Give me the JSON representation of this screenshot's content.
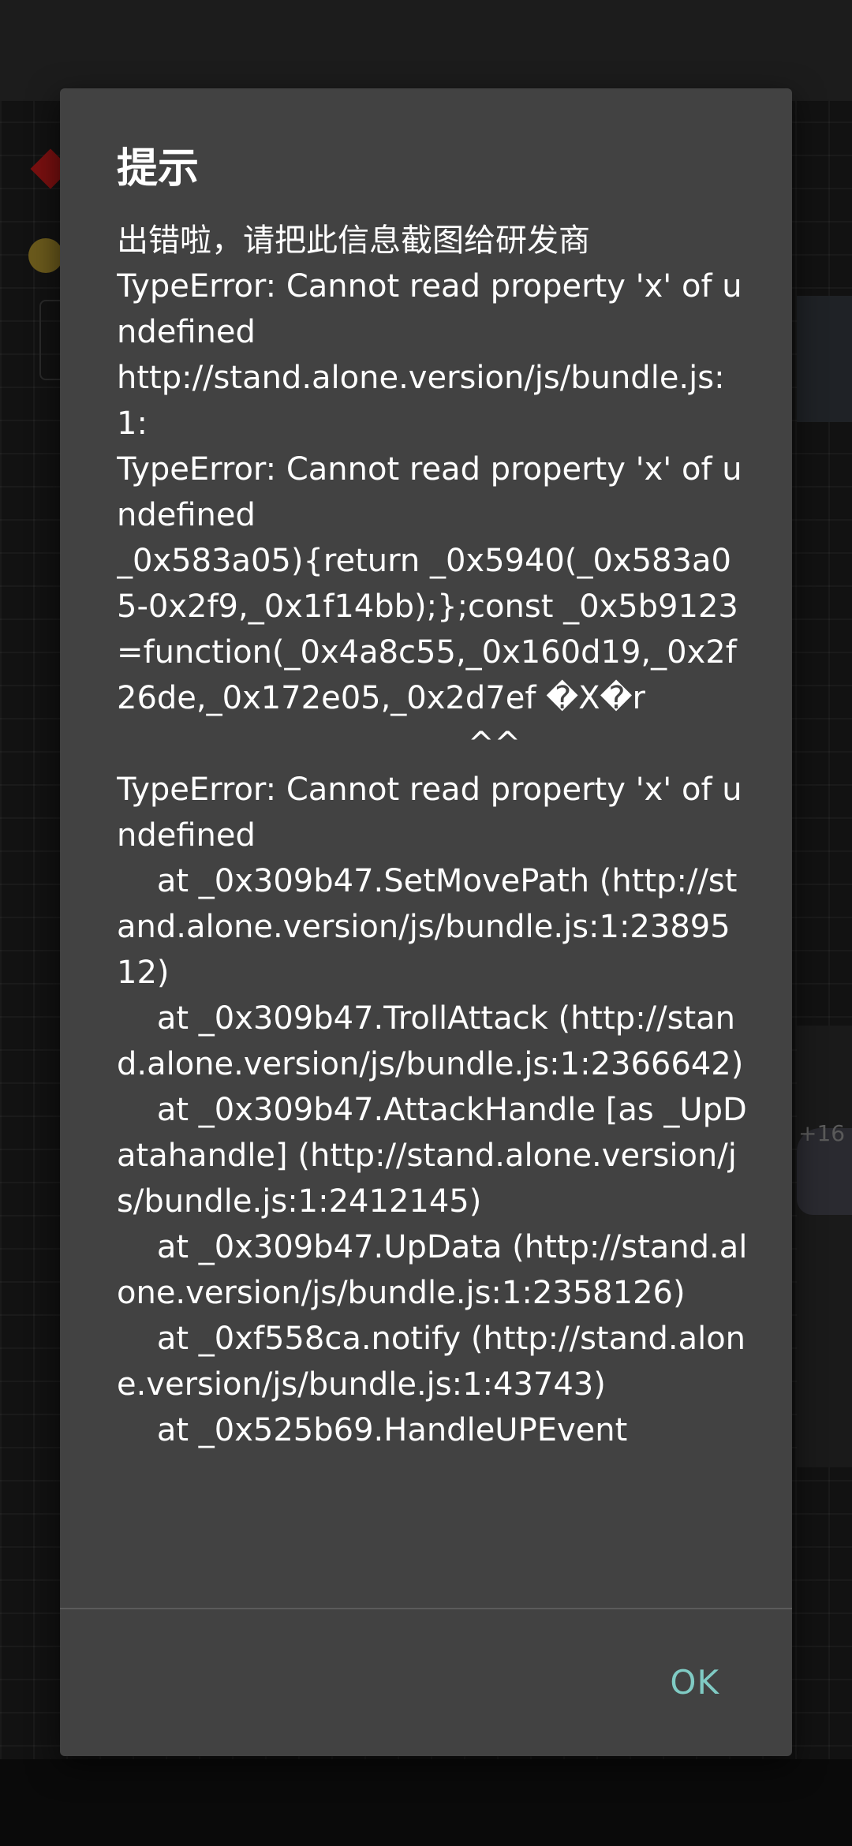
{
  "dialog": {
    "title": "提示",
    "message_intro": "出错啦，请把此信息截图给研发商",
    "message_body": "TypeError: Cannot read property 'x' of undefined\nhttp://stand.alone.version/js/bundle.js:1:\nTypeError: Cannot read property 'x' of undefined\n_0x583a05){return _0x5940(_0x583a05-0x2f9,_0x1f14bb);};const _0x5b9123=function(_0x4a8c55,_0x160d19,_0x2f26de,_0x172e05,_0x2d7ef �X�r\n                                   ^^\nTypeError: Cannot read property 'x' of undefined\n    at _0x309b47.SetMovePath (http://stand.alone.version/js/bundle.js:1:2389512)\n    at _0x309b47.TrollAttack (http://stand.alone.version/js/bundle.js:1:2366642)\n    at _0x309b47.AttackHandle [as _UpDatahandle] (http://stand.alone.version/js/bundle.js:1:2412145)\n    at _0x309b47.UpData (http://stand.alone.version/js/bundle.js:1:2358126)\n    at _0xf558ca.notify (http://stand.alone.version/js/bundle.js:1:43743)\n    at _0x525b69.HandleUPEvent",
    "ok_label": "OK"
  },
  "background": {
    "visible_text": "+16"
  },
  "colors": {
    "dialog_bg": "#424242",
    "text": "#ffffff",
    "accent": "#80cbc4",
    "scrim": "#0f0f0f"
  }
}
